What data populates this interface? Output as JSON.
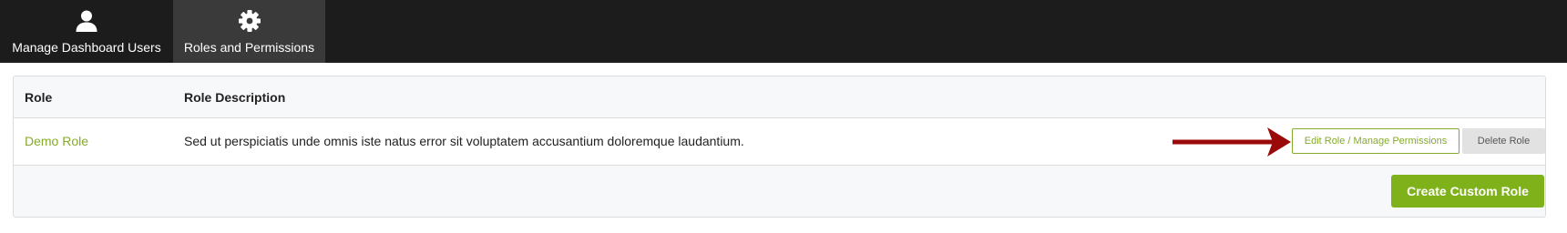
{
  "nav": {
    "tabs": [
      {
        "label": "Manage Dashboard Users",
        "icon": "user-icon",
        "active": false
      },
      {
        "label": "Roles and Permissions",
        "icon": "gear-icon",
        "active": true
      }
    ]
  },
  "table": {
    "headers": {
      "role": "Role",
      "description": "Role Description"
    },
    "rows": [
      {
        "role": "Demo Role",
        "description": "Sed ut perspiciatis unde omnis iste natus error sit voluptatem accusantium doloremque laudantium.",
        "edit_label": "Edit Role / Manage Permissions",
        "delete_label": "Delete Role"
      }
    ]
  },
  "footer": {
    "create_label": "Create Custom Role"
  },
  "colors": {
    "nav_bg": "#1c1c1c",
    "active_tab_bg": "#3a3a3a",
    "accent_green": "#7fb21a",
    "link_green": "#85ab2a",
    "annotation_arrow": "#9b0a0a"
  }
}
